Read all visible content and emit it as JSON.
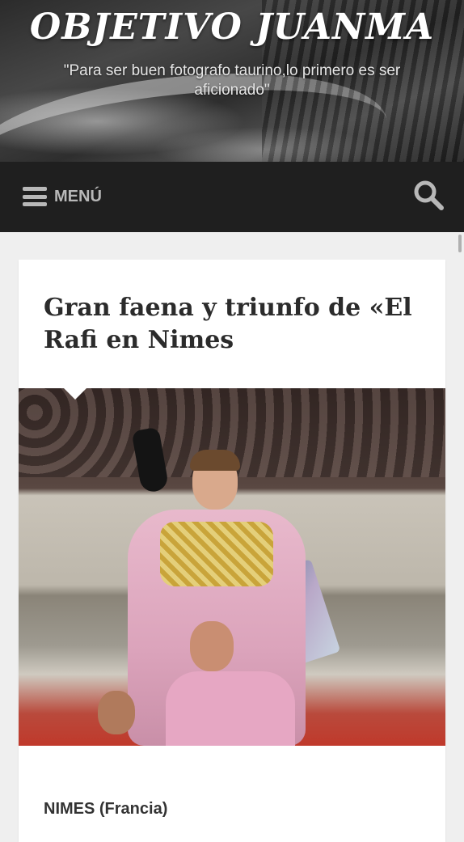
{
  "header": {
    "site_title": "OBJETIVO JUANMA",
    "tagline": "\"Para ser buen fotografo taurino,lo primero es ser aficionado\""
  },
  "nav": {
    "menu_label": "MENÚ",
    "menu_icon": "hamburger-icon",
    "search_icon": "search-icon"
  },
  "article": {
    "title": "Gran faena y triunfo de «El Rafi en Nimes",
    "location": "NIMES (Francia)"
  },
  "colors": {
    "nav_background": "#1f1f1f",
    "page_background": "#efefef",
    "title_text": "#2b2b2b"
  }
}
